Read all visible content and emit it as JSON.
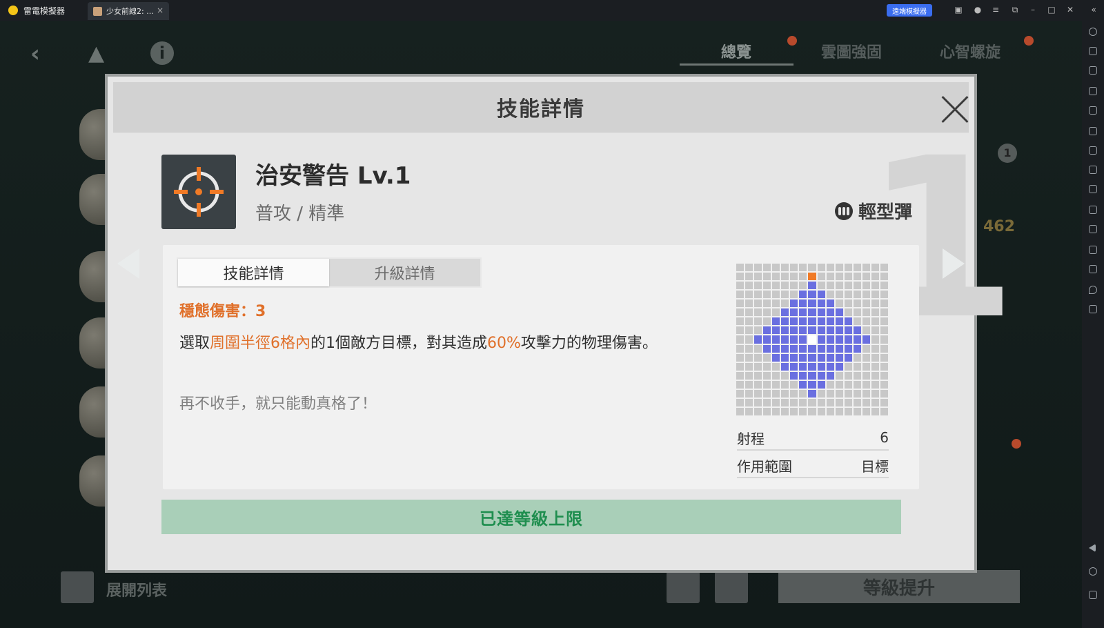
{
  "emulator": {
    "app_name": "雷電模擬器",
    "tab_label": "少女前線2: ...",
    "tab_close": "×",
    "remote_button": "遠端模擬器"
  },
  "background": {
    "tabs": [
      "總覽",
      "雲圖強固",
      "心智螺旋"
    ],
    "expand_list": "展開列表",
    "level_up": "等級提升",
    "number_462": "462",
    "badge_1": "1"
  },
  "modal": {
    "title": "技能詳情",
    "big_number": "1",
    "skill": {
      "name": "治安警告 Lv.1",
      "type": "普攻 / 精準",
      "ammo_type": "輕型彈"
    },
    "tabs": {
      "details": "技能詳情",
      "upgrade": "升級詳情"
    },
    "stat_line": "穩態傷害：3",
    "description": {
      "part1": "選取",
      "hl1": "周圍半徑6格內",
      "part2": "的1個敵方目標，對其造成",
      "hl2": "60%",
      "part3": "攻擊力的物理傷害。"
    },
    "flavor": "再不收手，就只能動真格了！",
    "range_label": "射程",
    "range_value": "6",
    "area_label": "作用範圍",
    "area_value": "目標",
    "maxed": "已達等級上限"
  },
  "colors": {
    "highlight": "#e0702a",
    "area_cell": "#6a6fe0",
    "target_cell": "#f07a26",
    "maxed_text": "#1f8e4f"
  }
}
